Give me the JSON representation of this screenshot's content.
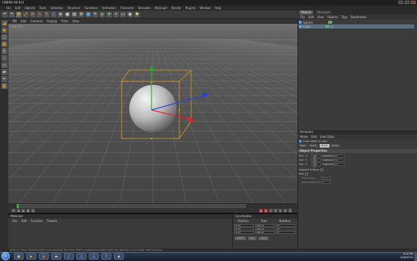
{
  "window": {
    "title": "CINEMA 4D R11"
  },
  "menubar": [
    "File",
    "Edit",
    "Objects",
    "Tools",
    "Selection",
    "Structure",
    "Functions",
    "Animation",
    "Character",
    "Simulate",
    "MoGraph",
    "Render",
    "Plugins",
    "Window",
    "Help"
  ],
  "toolbar_icons": [
    "undo-icon",
    "redo-icon",
    "move-icon",
    "scale-icon",
    "rotate-icon",
    "x-axis-icon",
    "y-axis-icon",
    "z-axis-icon",
    "coordinate-icon",
    "render-view-icon",
    "render-picture-icon",
    "render-settings-icon",
    "cube-icon",
    "pen-icon",
    "subdivision-icon",
    "array-icon",
    "deformer-icon",
    "floor-icon",
    "camera-icon",
    "light-icon"
  ],
  "left_tools": [
    "make-editable-icon",
    "model-icon",
    "object-icon",
    "texture-icon",
    "axis-icon",
    "points-icon",
    "edges-icon",
    "polygons-icon",
    "snap-icon",
    "workplane-icon"
  ],
  "viewport": {
    "menu": [
      "Edit",
      "Cameras",
      "Display",
      "Filter",
      "View"
    ],
    "label": "Perspective",
    "colors": {
      "bg_top": "#6c6c6c",
      "bg_bottom": "#444444",
      "bbox": "#e69a1c",
      "x_axis": "#e02424",
      "y_axis": "#1fb51f",
      "z_axis": "#2244dd"
    }
  },
  "materials": {
    "header": "Materials",
    "menu": [
      "File",
      "Edit",
      "Function",
      "Texture"
    ]
  },
  "coordinates": {
    "header": "Coordinates",
    "columns": [
      "Position",
      "Size",
      "Rotation"
    ],
    "rows": [
      {
        "pos": "0 cm",
        "size": "200 cm",
        "rot": "0 °"
      },
      {
        "pos": "0 cm",
        "size": "200 cm",
        "rot": "0 °"
      },
      {
        "pos": "0 cm",
        "size": "200 cm",
        "rot": "0 °"
      }
    ],
    "mode_select": "Object",
    "size_select": "Size",
    "apply_label": "Apply"
  },
  "objects_panel": {
    "tabs": [
      "Objects",
      "Structure"
    ],
    "menu": [
      "File",
      "Edit",
      "View",
      "Objects",
      "Tags",
      "Bookmarks"
    ],
    "items": [
      {
        "name": "Sphere"
      },
      {
        "name": "Cube"
      }
    ]
  },
  "attributes": {
    "header": "Attributes",
    "menu": [
      "Mode",
      "Edit",
      "User Data"
    ],
    "object_title": "Cube Object [Cube]",
    "tabs": [
      "Basic",
      "Coord.",
      "Object",
      "Phong"
    ],
    "section": "Object Properties",
    "size_rows": [
      {
        "label": "Size . X",
        "value": "200 cm",
        "seg_label": "Segments X",
        "seg": "1"
      },
      {
        "label": "Size . Y",
        "value": "200 cm",
        "seg_label": "Segments Y",
        "seg": "1"
      },
      {
        "label": "Size . Z",
        "value": "200 cm",
        "seg_label": "Segments Z",
        "seg": "1"
      }
    ],
    "separate_surfaces": "Separate Surfaces",
    "fillet": "Fillet",
    "fillet_radius_label": "Fillet Radius",
    "fillet_radius": "40 cm",
    "fillet_subdivision_label": "Fillet Subdivision",
    "fillet_subdivision": "5"
  },
  "status": "00:00:13 - Move: Click and drag to move elements. Hold down SHIFT to quantize movement / add to the selection in point mode, CTRL to remove.",
  "taskbar": {
    "apps": [
      "explorer-icon",
      "media-player-icon",
      "firefox-icon",
      "folder-icon",
      "winamp-icon",
      "itunes-icon",
      "cinema4d-icon",
      "photoshop-icon",
      "app-icon"
    ],
    "time": "6:26 PM",
    "date": "4/26/2010"
  }
}
